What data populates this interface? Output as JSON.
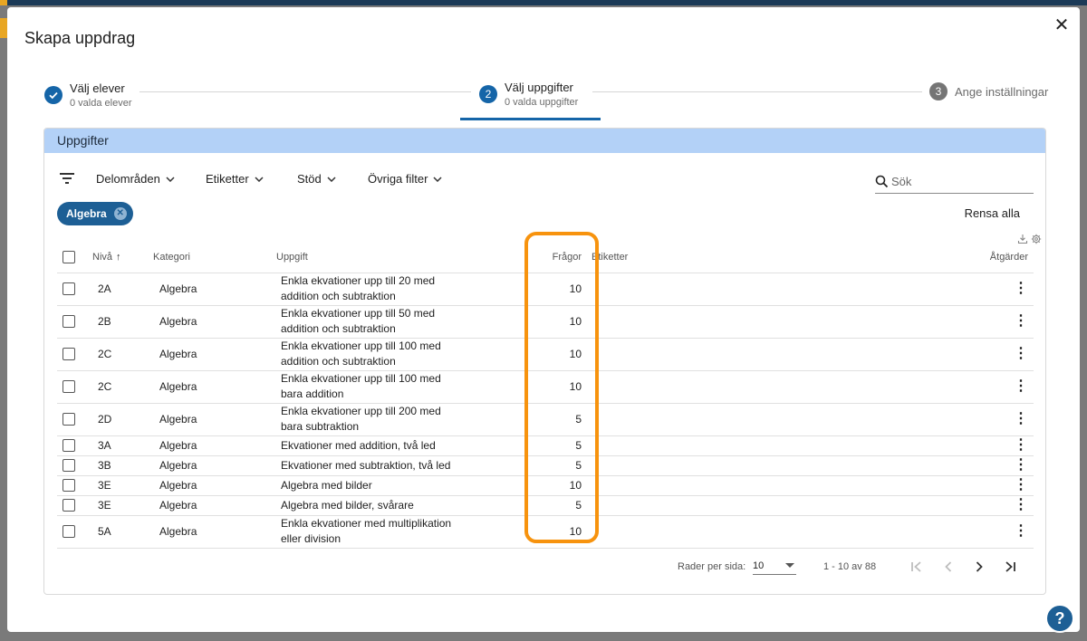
{
  "modal": {
    "title": "Skapa uppdrag",
    "close_icon": "close-icon"
  },
  "stepper": {
    "steps": [
      {
        "label": "Välj elever",
        "sub": "0 valda elever",
        "status": "done",
        "icon": "check-icon"
      },
      {
        "label": "Välj uppgifter",
        "sub": "0 valda uppgifter",
        "status": "active",
        "number": "2"
      },
      {
        "label": "Ange inställningar",
        "status": "pending",
        "number": "3"
      }
    ]
  },
  "card": {
    "title": "Uppgifter"
  },
  "filters": {
    "items": [
      "Delområden",
      "Etiketter",
      "Stöd",
      "Övriga filter"
    ],
    "search_placeholder": "Sök"
  },
  "active_chip": "Algebra",
  "clear_all": "Rensa alla",
  "table": {
    "headers": {
      "level": "Nivå",
      "category": "Kategori",
      "task": "Uppgift",
      "questions": "Frågor",
      "tags": "Etiketter",
      "actions": "Åtgärder"
    },
    "rows": [
      {
        "level": "2A",
        "category": "Algebra",
        "task_l1": "Enkla ekvationer upp till 20 med",
        "task_l2": "addition och subtraktion",
        "questions": "10"
      },
      {
        "level": "2B",
        "category": "Algebra",
        "task_l1": "Enkla ekvationer upp till 50 med",
        "task_l2": "addition och subtraktion",
        "questions": "10"
      },
      {
        "level": "2C",
        "category": "Algebra",
        "task_l1": "Enkla ekvationer upp till 100 med",
        "task_l2": "addition och subtraktion",
        "questions": "10"
      },
      {
        "level": "2C",
        "category": "Algebra",
        "task_l1": "Enkla ekvationer upp till 100 med",
        "task_l2": "bara addition",
        "questions": "10"
      },
      {
        "level": "2D",
        "category": "Algebra",
        "task_l1": "Enkla ekvationer upp till 200 med",
        "task_l2": "bara subtraktion",
        "questions": "5"
      },
      {
        "level": "3A",
        "category": "Algebra",
        "task_l1": "Ekvationer med addition, två led",
        "task_l2": "",
        "questions": "5"
      },
      {
        "level": "3B",
        "category": "Algebra",
        "task_l1": "Ekvationer med subtraktion, två led",
        "task_l2": "",
        "questions": "5"
      },
      {
        "level": "3E",
        "category": "Algebra",
        "task_l1": "Algebra med bilder",
        "task_l2": "",
        "questions": "10"
      },
      {
        "level": "3E",
        "category": "Algebra",
        "task_l1": "Algebra med bilder, svårare",
        "task_l2": "",
        "questions": "5"
      },
      {
        "level": "5A",
        "category": "Algebra",
        "task_l1": "Enkla ekvationer med multiplikation",
        "task_l2": "eller division",
        "questions": "10"
      }
    ]
  },
  "pager": {
    "rows_per_page_label": "Rader per sida:",
    "rows_per_page": "10",
    "range": "1 - 10 av 88"
  },
  "help_icon": "help-icon",
  "colors": {
    "primary": "#1d5f95",
    "header_bg": "#b3d1f7",
    "highlight": "#f7930e",
    "step_active": "#1565a8"
  }
}
